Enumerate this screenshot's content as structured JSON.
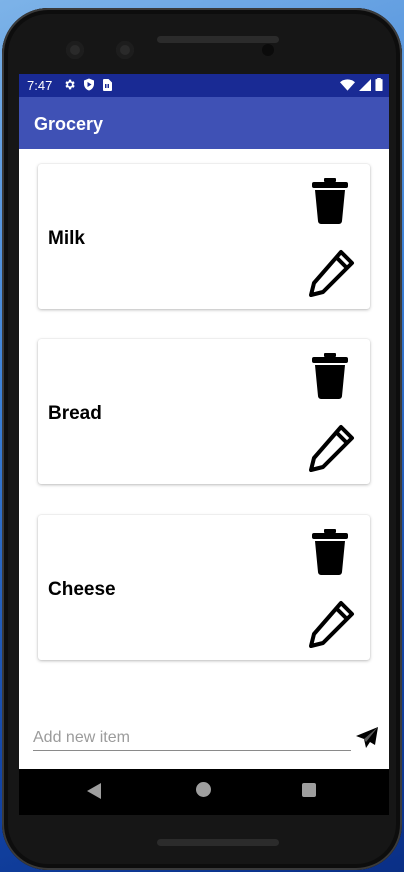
{
  "status_bar": {
    "time": "7:47",
    "left_icons": [
      "settings-icon",
      "play-protect-icon",
      "sim-card-icon"
    ],
    "right_icons": [
      "wifi-icon",
      "signal-icon",
      "battery-icon"
    ]
  },
  "app_bar": {
    "title": "Grocery"
  },
  "items": [
    {
      "label": "Milk"
    },
    {
      "label": "Bread"
    },
    {
      "label": "Cheese"
    }
  ],
  "new_item": {
    "placeholder": "Add new item",
    "value": ""
  },
  "colors": {
    "status_bar": "#192a94",
    "app_bar": "#3f51b5",
    "icon": "#000000"
  }
}
